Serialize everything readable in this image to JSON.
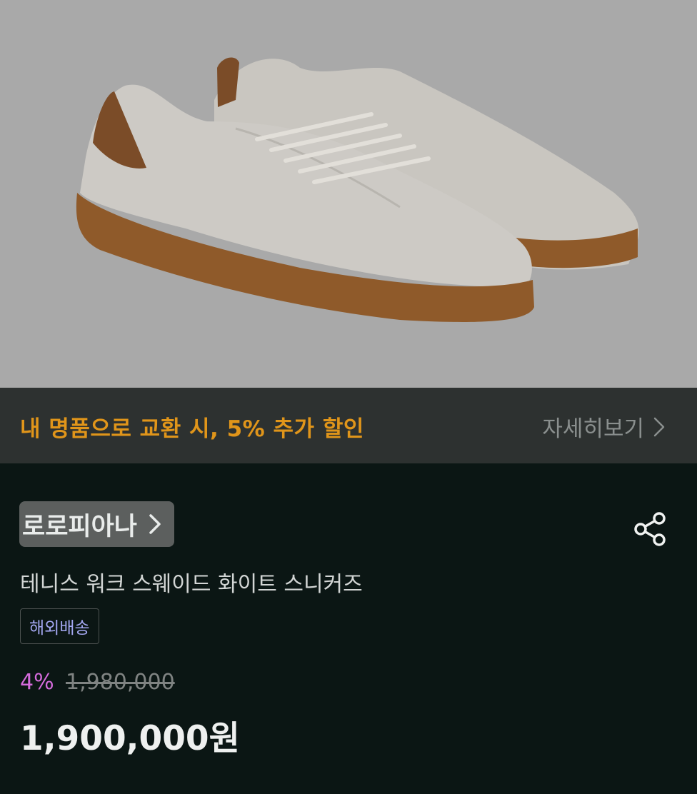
{
  "hero": {
    "image": "white-suede-sneakers-gum-sole"
  },
  "promo": {
    "text": "내 명품으로 교환 시, 5% 추가 할인",
    "link_label": "자세히보기"
  },
  "product": {
    "brand": "로로피아나",
    "title": "테니스 워크 스웨이드 화이트 스니커즈",
    "badge": "해외배송",
    "discount": "4%",
    "original_price": "1,980,000",
    "price": "1,900,000원"
  },
  "colors": {
    "promo_accent": "#e0951a",
    "discount_accent": "#d56bdc",
    "badge_text": "#a4a8f2",
    "background": "#0b1614"
  },
  "icons": [
    "chevron-right-icon",
    "share-icon"
  ]
}
